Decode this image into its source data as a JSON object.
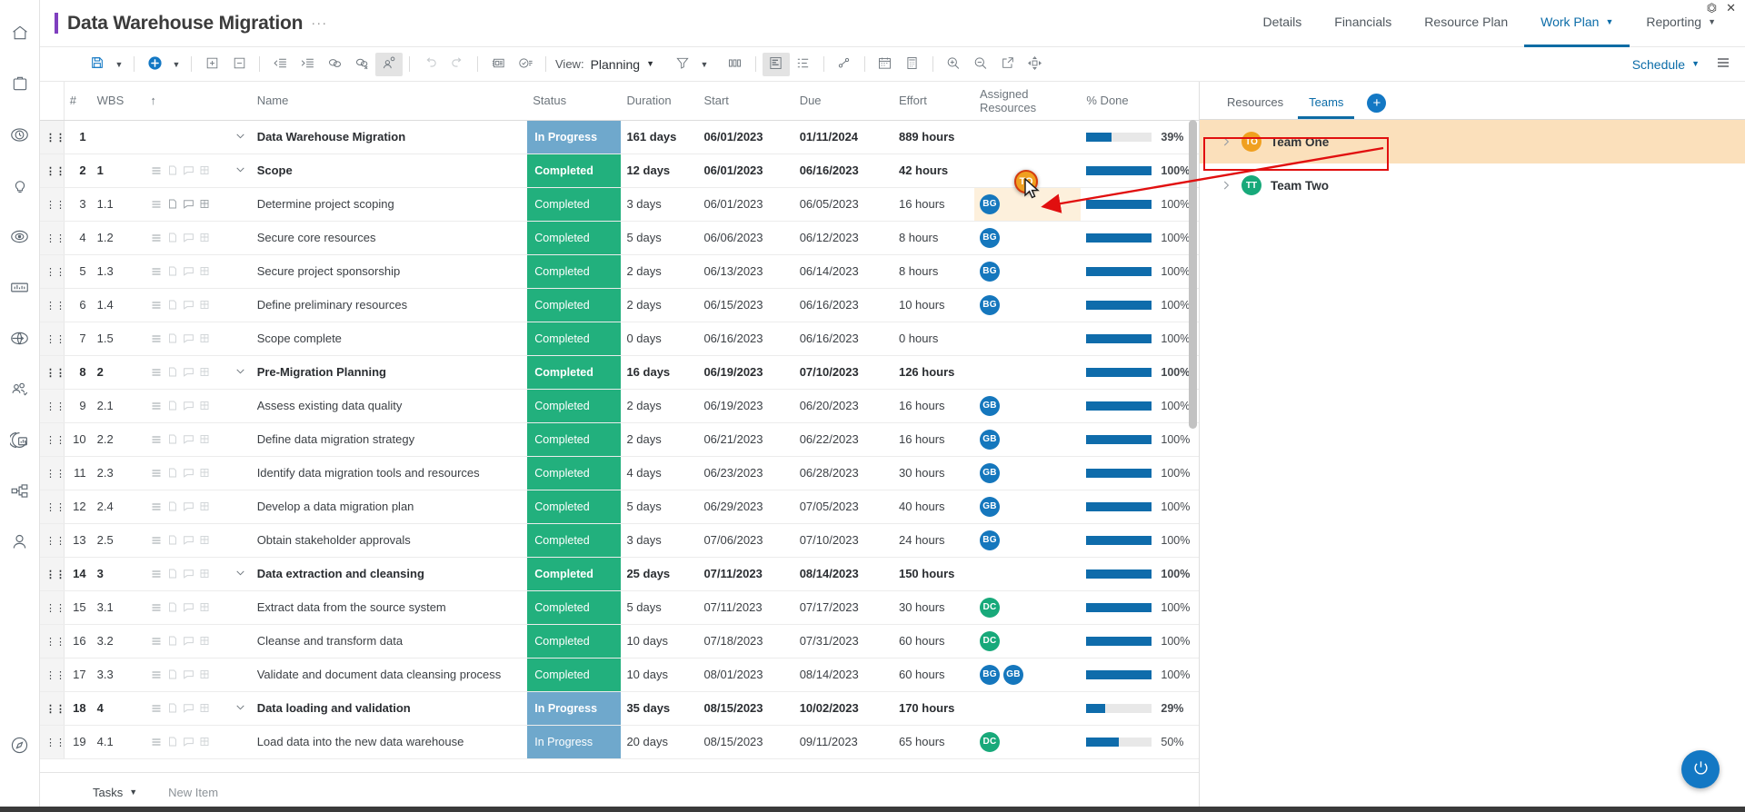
{
  "window": {
    "restore_icon": "restore-icon",
    "close_icon": "close-icon"
  },
  "rail": {
    "items": [
      {
        "name": "home-icon",
        "label": "Home"
      },
      {
        "name": "briefcase-icon",
        "label": "Portfolio"
      },
      {
        "name": "clock-icon",
        "label": "Timesheets"
      },
      {
        "name": "lightbulb-icon",
        "label": "Ideas"
      },
      {
        "name": "target-icon",
        "label": "Objectives"
      },
      {
        "name": "chart-icon",
        "label": "Analytics"
      },
      {
        "name": "globe-icon",
        "label": "Global"
      },
      {
        "name": "people-check-icon",
        "label": "Resources"
      },
      {
        "name": "pie-report-icon",
        "label": "Reports"
      },
      {
        "name": "org-chart-icon",
        "label": "Organization"
      },
      {
        "name": "person-icon",
        "label": "Profile"
      },
      {
        "name": "compass-icon",
        "label": "Explore"
      }
    ]
  },
  "header": {
    "title": "Data Warehouse Migration",
    "ellipsis": "···",
    "tabs": [
      {
        "label": "Details",
        "active": false,
        "caret": false
      },
      {
        "label": "Financials",
        "active": false,
        "caret": false
      },
      {
        "label": "Resource Plan",
        "active": false,
        "caret": false
      },
      {
        "label": "Work Plan",
        "active": true,
        "caret": true
      },
      {
        "label": "Reporting",
        "active": false,
        "caret": true
      }
    ]
  },
  "toolbar": {
    "save_icon": "save-icon",
    "save_caret": "▼",
    "add_icon": "add-circle-icon",
    "add_caret": "▼",
    "expand_icon": "expand-all-icon",
    "collapse_icon": "collapse-all-icon",
    "outdent_icon": "outdent-icon",
    "indent_icon": "indent-icon",
    "link_icon": "link-tasks-icon",
    "unlink_icon": "unlink-tasks-icon",
    "assign_icon": "assign-resource-icon",
    "undo_icon": "undo-icon",
    "redo_icon": "redo-icon",
    "notes_icon": "task-notes-icon",
    "approvals_icon": "approvals-icon",
    "view_label": "View:",
    "view_value": "Planning",
    "view_caret": "▼",
    "filter_icon": "filter-icon",
    "filter_caret": "▼",
    "columns_icon": "columns-icon",
    "gantt_icon": "gantt-view-icon",
    "list_icon": "list-view-icon",
    "baseline_icon": "baseline-icon",
    "calendar_icon": "calendar-icon",
    "timesheet_icon": "timesheet-icon",
    "zoom_in_icon": "zoom-in-icon",
    "zoom_out_icon": "zoom-out-icon",
    "open_external_icon": "open-external-icon",
    "fit_icon": "fit-to-screen-icon",
    "schedule_label": "Schedule",
    "schedule_caret": "▼",
    "menu_icon": "hamburger-menu-icon"
  },
  "grid": {
    "columns": [
      {
        "key": "num",
        "label": "#"
      },
      {
        "key": "wbs",
        "label": "WBS"
      },
      {
        "key": "sort",
        "label": "↑"
      },
      {
        "key": "name",
        "label": "Name"
      },
      {
        "key": "status",
        "label": "Status"
      },
      {
        "key": "duration",
        "label": "Duration"
      },
      {
        "key": "start",
        "label": "Start"
      },
      {
        "key": "due",
        "label": "Due"
      },
      {
        "key": "effort",
        "label": "Effort"
      },
      {
        "key": "resources",
        "label": "Assigned Resources"
      },
      {
        "key": "done",
        "label": "% Done"
      }
    ],
    "rows": [
      {
        "num": "1",
        "wbs": "",
        "name": "Data Warehouse Migration",
        "level": 0,
        "summary": true,
        "toggle": "expanded",
        "showIcons": false,
        "status": "In Progress",
        "statusType": "in-progress",
        "duration": "161 days",
        "start": "06/01/2023",
        "due": "01/11/2024",
        "dueOverdue": false,
        "effort": "889 hours",
        "resources": [],
        "pct": 39
      },
      {
        "num": "2",
        "wbs": "1",
        "name": "Scope",
        "level": 1,
        "summary": true,
        "toggle": "expanded",
        "showIcons": true,
        "status": "Completed",
        "statusType": "completed",
        "duration": "12 days",
        "start": "06/01/2023",
        "due": "06/16/2023",
        "dueOverdue": false,
        "effort": "42 hours",
        "resources": [],
        "pct": 100
      },
      {
        "num": "3",
        "wbs": "1.1",
        "name": "Determine project scoping",
        "level": 2,
        "summary": false,
        "toggle": "none",
        "showIcons": true,
        "iconsActive": true,
        "status": "Completed",
        "statusType": "completed",
        "duration": "3 days",
        "start": "06/01/2023",
        "due": "06/05/2023",
        "dueOverdue": false,
        "effort": "16 hours",
        "resources": [
          {
            "initials": "BG",
            "color": "blue"
          }
        ],
        "pct": 100,
        "dropTarget": true
      },
      {
        "num": "4",
        "wbs": "1.2",
        "name": "Secure core resources",
        "level": 2,
        "summary": false,
        "toggle": "none",
        "showIcons": true,
        "status": "Completed",
        "statusType": "completed",
        "duration": "5 days",
        "start": "06/06/2023",
        "due": "06/12/2023",
        "dueOverdue": false,
        "effort": "8 hours",
        "resources": [
          {
            "initials": "BG",
            "color": "blue"
          }
        ],
        "pct": 100
      },
      {
        "num": "5",
        "wbs": "1.3",
        "name": "Secure project sponsorship",
        "level": 2,
        "summary": false,
        "toggle": "none",
        "showIcons": true,
        "status": "Completed",
        "statusType": "completed",
        "duration": "2 days",
        "start": "06/13/2023",
        "due": "06/14/2023",
        "dueOverdue": false,
        "effort": "8 hours",
        "resources": [
          {
            "initials": "BG",
            "color": "blue"
          }
        ],
        "pct": 100
      },
      {
        "num": "6",
        "wbs": "1.4",
        "name": "Define preliminary resources",
        "level": 2,
        "summary": false,
        "toggle": "none",
        "showIcons": true,
        "status": "Completed",
        "statusType": "completed",
        "duration": "2 days",
        "start": "06/15/2023",
        "due": "06/16/2023",
        "dueOverdue": false,
        "effort": "10 hours",
        "resources": [
          {
            "initials": "BG",
            "color": "blue"
          }
        ],
        "pct": 100
      },
      {
        "num": "7",
        "wbs": "1.5",
        "name": "Scope complete",
        "level": 2,
        "summary": false,
        "toggle": "none",
        "showIcons": true,
        "status": "Completed",
        "statusType": "completed",
        "duration": "0 days",
        "start": "06/16/2023",
        "due": "06/16/2023",
        "dueOverdue": false,
        "effort": "0 hours",
        "resources": [],
        "pct": 100
      },
      {
        "num": "8",
        "wbs": "2",
        "name": "Pre-Migration Planning",
        "level": 1,
        "summary": true,
        "toggle": "expanded",
        "showIcons": true,
        "status": "Completed",
        "statusType": "completed",
        "duration": "16 days",
        "start": "06/19/2023",
        "due": "07/10/2023",
        "dueOverdue": false,
        "effort": "126 hours",
        "resources": [],
        "pct": 100
      },
      {
        "num": "9",
        "wbs": "2.1",
        "name": "Assess existing data quality",
        "level": 2,
        "summary": false,
        "toggle": "none",
        "showIcons": true,
        "status": "Completed",
        "statusType": "completed",
        "duration": "2 days",
        "start": "06/19/2023",
        "due": "06/20/2023",
        "dueOverdue": false,
        "effort": "16 hours",
        "resources": [
          {
            "initials": "GB",
            "color": "blue"
          }
        ],
        "pct": 100
      },
      {
        "num": "10",
        "wbs": "2.2",
        "name": "Define data migration strategy",
        "level": 2,
        "summary": false,
        "toggle": "none",
        "showIcons": true,
        "status": "Completed",
        "statusType": "completed",
        "duration": "2 days",
        "start": "06/21/2023",
        "due": "06/22/2023",
        "dueOverdue": false,
        "effort": "16 hours",
        "resources": [
          {
            "initials": "GB",
            "color": "blue"
          }
        ],
        "pct": 100
      },
      {
        "num": "11",
        "wbs": "2.3",
        "name": "Identify data migration tools and resources",
        "level": 2,
        "summary": false,
        "toggle": "none",
        "showIcons": true,
        "status": "Completed",
        "statusType": "completed",
        "duration": "4 days",
        "start": "06/23/2023",
        "due": "06/28/2023",
        "dueOverdue": false,
        "effort": "30 hours",
        "resources": [
          {
            "initials": "GB",
            "color": "blue"
          }
        ],
        "pct": 100
      },
      {
        "num": "12",
        "wbs": "2.4",
        "name": "Develop a data migration plan",
        "level": 2,
        "summary": false,
        "toggle": "none",
        "showIcons": true,
        "status": "Completed",
        "statusType": "completed",
        "duration": "5 days",
        "start": "06/29/2023",
        "due": "07/05/2023",
        "dueOverdue": false,
        "effort": "40 hours",
        "resources": [
          {
            "initials": "GB",
            "color": "blue"
          }
        ],
        "pct": 100
      },
      {
        "num": "13",
        "wbs": "2.5",
        "name": "Obtain stakeholder approvals",
        "level": 2,
        "summary": false,
        "toggle": "none",
        "showIcons": true,
        "status": "Completed",
        "statusType": "completed",
        "duration": "3 days",
        "start": "07/06/2023",
        "due": "07/10/2023",
        "dueOverdue": false,
        "effort": "24 hours",
        "resources": [
          {
            "initials": "BG",
            "color": "blue"
          }
        ],
        "pct": 100
      },
      {
        "num": "14",
        "wbs": "3",
        "name": "Data extraction and cleansing",
        "level": 1,
        "summary": true,
        "toggle": "expanded",
        "showIcons": true,
        "status": "Completed",
        "statusType": "completed",
        "duration": "25 days",
        "start": "07/11/2023",
        "due": "08/14/2023",
        "dueOverdue": false,
        "effort": "150 hours",
        "resources": [],
        "pct": 100
      },
      {
        "num": "15",
        "wbs": "3.1",
        "name": "Extract data from the source system",
        "level": 2,
        "summary": false,
        "toggle": "none",
        "showIcons": true,
        "status": "Completed",
        "statusType": "completed",
        "duration": "5 days",
        "start": "07/11/2023",
        "due": "07/17/2023",
        "dueOverdue": false,
        "effort": "30 hours",
        "resources": [
          {
            "initials": "DC",
            "color": "green"
          }
        ],
        "pct": 100
      },
      {
        "num": "16",
        "wbs": "3.2",
        "name": "Cleanse and transform data",
        "level": 2,
        "summary": false,
        "toggle": "none",
        "showIcons": true,
        "status": "Completed",
        "statusType": "completed",
        "duration": "10 days",
        "start": "07/18/2023",
        "due": "07/31/2023",
        "dueOverdue": false,
        "effort": "60 hours",
        "resources": [
          {
            "initials": "DC",
            "color": "green"
          }
        ],
        "pct": 100
      },
      {
        "num": "17",
        "wbs": "3.3",
        "name": "Validate and document data cleansing process",
        "level": 2,
        "summary": false,
        "toggle": "none",
        "showIcons": true,
        "status": "Completed",
        "statusType": "completed",
        "duration": "10 days",
        "start": "08/01/2023",
        "due": "08/14/2023",
        "dueOverdue": false,
        "effort": "60 hours",
        "resources": [
          {
            "initials": "BG",
            "color": "blue"
          },
          {
            "initials": "GB",
            "color": "blue"
          }
        ],
        "pct": 100
      },
      {
        "num": "18",
        "wbs": "4",
        "name": "Data loading and validation",
        "level": 1,
        "summary": true,
        "toggle": "expanded",
        "showIcons": true,
        "status": "In Progress",
        "statusType": "in-progress",
        "duration": "35 days",
        "start": "08/15/2023",
        "due": "10/02/2023",
        "dueOverdue": true,
        "effort": "170 hours",
        "resources": [],
        "pct": 29
      },
      {
        "num": "19",
        "wbs": "4.1",
        "name": "Load data into the new data warehouse",
        "level": 2,
        "summary": false,
        "toggle": "none",
        "showIcons": true,
        "status": "In Progress",
        "statusType": "in-progress",
        "duration": "20 days",
        "start": "08/15/2023",
        "due": "09/11/2023",
        "dueOverdue": true,
        "effort": "65 hours",
        "resources": [
          {
            "initials": "DC",
            "color": "green"
          }
        ],
        "pct": 50
      }
    ],
    "footer": {
      "tasks_label": "Tasks",
      "tasks_caret": "▼",
      "new_item_label": "New Item"
    }
  },
  "rightPanel": {
    "tabs": [
      {
        "label": "Resources",
        "active": false
      },
      {
        "label": "Teams",
        "active": true
      }
    ],
    "add_label": "+",
    "teams": [
      {
        "initials": "TO",
        "name": "Team One",
        "color": "orange",
        "selected": true,
        "chevron": "chevron-right-icon"
      },
      {
        "initials": "TT",
        "name": "Team Two",
        "color": "green",
        "selected": false,
        "chevron": "chevron-right-icon"
      }
    ]
  },
  "overlay": {
    "drag_avatar_initials": "TO",
    "highlight_color": "#e10f0f",
    "annotation_arrow": "drag-direction-arrow"
  },
  "fab": {
    "icon": "help-power-icon"
  },
  "colors": {
    "accent_blue": "#0b6ca8",
    "completed_green": "#22b07d",
    "in_progress_blue": "#6fa8cc",
    "progress_bar": "#0f6cab",
    "overdue_red": "#e02020",
    "team_highlight": "#fbe0bb",
    "avatar_orange": "#f0a020"
  }
}
